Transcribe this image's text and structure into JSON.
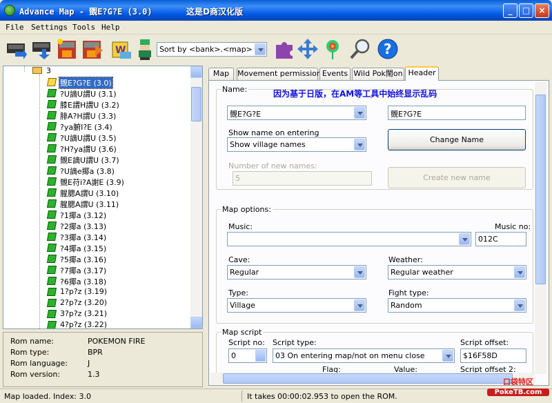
{
  "window": {
    "title": "Advance Map - 覴E?G?E (3.0)",
    "subtitle": "这是D商汉化版",
    "controls": [
      "_",
      "□",
      "×"
    ]
  },
  "menu": [
    "File",
    "Settings",
    "Tools",
    "Help"
  ],
  "toolbar": {
    "sort_value": "Sort by <bank>.<map>",
    "icons": [
      "open-rom-icon",
      "save-rom-icon",
      "import-map-icon",
      "export-map-icon",
      "wild-pokemon-icon",
      "trainer-icon",
      "puzzle-icon",
      "move-arrows-icon",
      "flower-icon",
      "search-icon",
      "help-icon"
    ]
  },
  "tree": {
    "folder_label": "3",
    "items": [
      {
        "label": "覴E?G?E (3.0)",
        "selected": true
      },
      {
        "label": "?U謫U謂U (3.1)"
      },
      {
        "label": "膝E謂H謂U (3.2)"
      },
      {
        "label": "腓A?H謂U (3.3)"
      },
      {
        "label": "?ya腑I?E (3.4)"
      },
      {
        "label": "?U謫U謂U (3.5)"
      },
      {
        "label": "?H?ya謂U (3.6)"
      },
      {
        "label": "覴E謫U謂U (3.7)"
      },
      {
        "label": "?U謫e揶a (3.8)"
      },
      {
        "label": "覴E苻i?A謝E (3.9)"
      },
      {
        "label": "腥腮A謂U (3.10)"
      },
      {
        "label": "腥腮A謂U (3.11)"
      },
      {
        "label": "?1揶a (3.12)"
      },
      {
        "label": "?2揶a (3.13)"
      },
      {
        "label": "?3揶a (3.14)"
      },
      {
        "label": "?4揶a (3.15)"
      },
      {
        "label": "?5揶a (3.16)"
      },
      {
        "label": "?7揶a (3.17)"
      },
      {
        "label": "?6揶a (3.18)"
      },
      {
        "label": "1?p?z (3.19)"
      },
      {
        "label": "2?p?z (3.20)"
      },
      {
        "label": "3?p?z (3.21)"
      },
      {
        "label": "4?p?z (3.22)"
      }
    ]
  },
  "rom_info": [
    {
      "key": "Rom name:",
      "value": "POKEMON FIRE"
    },
    {
      "key": "Rom type:",
      "value": "BPR"
    },
    {
      "key": "Rom language:",
      "value": "J"
    },
    {
      "key": "Rom version:",
      "value": "1.3"
    }
  ],
  "status": {
    "left": "Map loaded.  Index: 3.0",
    "right": "It takes 00:00:02.953 to open the ROM."
  },
  "tabs": [
    "Map",
    "Movement permissions",
    "Events",
    "Wild Pok閙on",
    "Header"
  ],
  "active_tab": "Header",
  "header": {
    "name_group": "Name:",
    "name_note": "因为基于日版，在AM等工具中始终显示乱码",
    "name_select": "覴E?G?E",
    "name_text": "覴E?G?E",
    "change_name_button": "Change Name",
    "show_name_label": "Show name on entering",
    "show_name_value": "Show village names",
    "new_names_label": "Number of new names:",
    "new_names_value": "5",
    "create_name_button": "Create new name",
    "map_options_group": "Map options:",
    "music_label": "Music:",
    "music_value": "",
    "music_no_label": "Music no:",
    "music_no_value": "012C",
    "cave_label": "Cave:",
    "cave_value": "Regular",
    "weather_label": "Weather:",
    "weather_value": "Regular weather",
    "type_label": "Type:",
    "type_value": "Village",
    "fight_type_label": "Fight type:",
    "fight_type_value": "Random",
    "map_script_group": "Map script",
    "script_no_label": "Script no:",
    "script_no_value": "0",
    "script_type_label": "Script type:",
    "script_type_value": "03 On entering map/not on menu close",
    "script_offset_label": "Script offset:",
    "script_offset_value": "$16F58D",
    "flag_label": "Flag:",
    "value_label": "Value:",
    "script_offset2_label": "Script offset 2:"
  },
  "watermark": {
    "line1": "口袋特区",
    "line2": "PokeTB.com"
  },
  "colors": {
    "titlebar": "#0058e6",
    "selection": "#316ac5",
    "note": "#1010e0",
    "active_tab_accent": "#ffc83c"
  }
}
